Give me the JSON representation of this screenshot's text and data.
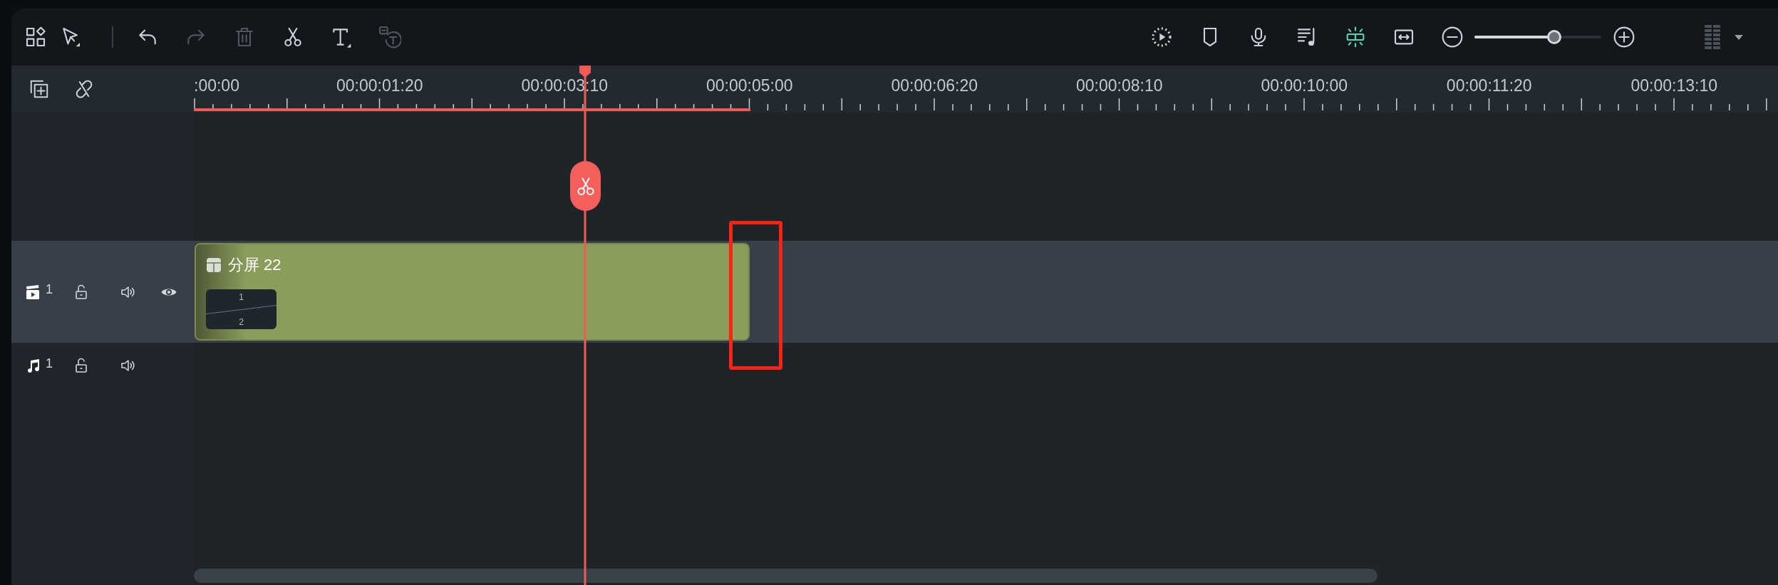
{
  "toolbar": {
    "left": [
      {
        "kind": "elements",
        "disabled": false
      },
      {
        "kind": "select",
        "disabled": false
      },
      {
        "kind": "undo",
        "disabled": false
      },
      {
        "kind": "redo",
        "disabled": true
      },
      {
        "kind": "delete",
        "disabled": true
      },
      {
        "kind": "split",
        "disabled": false
      },
      {
        "kind": "text",
        "disabled": false
      },
      {
        "kind": "speech-to-text",
        "disabled": true
      }
    ],
    "right": [
      {
        "kind": "render-preview",
        "active": false
      },
      {
        "kind": "marker",
        "active": false
      },
      {
        "kind": "voiceover",
        "active": false
      },
      {
        "kind": "audio-list",
        "active": false
      },
      {
        "kind": "snap",
        "active": true
      },
      {
        "kind": "fit",
        "active": false
      },
      {
        "kind": "zoom-out",
        "active": false
      },
      {
        "kind": "zoom-slider",
        "level": 0.63
      },
      {
        "kind": "zoom-in",
        "active": false
      },
      {
        "kind": "layout"
      },
      {
        "kind": "menu-caret"
      }
    ]
  },
  "track_tools": [
    {
      "kind": "add-track"
    },
    {
      "kind": "unlink"
    }
  ],
  "ruler": {
    "labels": [
      ":00:00",
      "00:00:01:20",
      "00:00:03:10",
      "00:00:05:00",
      "00:00:06:20",
      "00:00:08:10",
      "00:00:10:00",
      "00:00:11:20",
      "00:00:13:10"
    ]
  },
  "tracks": [
    {
      "kind": "video",
      "number": "1",
      "clips": [
        {
          "title": "分屏 22",
          "thumbnail_labels": [
            "1",
            "2"
          ]
        }
      ]
    },
    {
      "kind": "audio",
      "number": "1"
    }
  ],
  "annotations": [
    {
      "kind": "rectangle"
    }
  ]
}
